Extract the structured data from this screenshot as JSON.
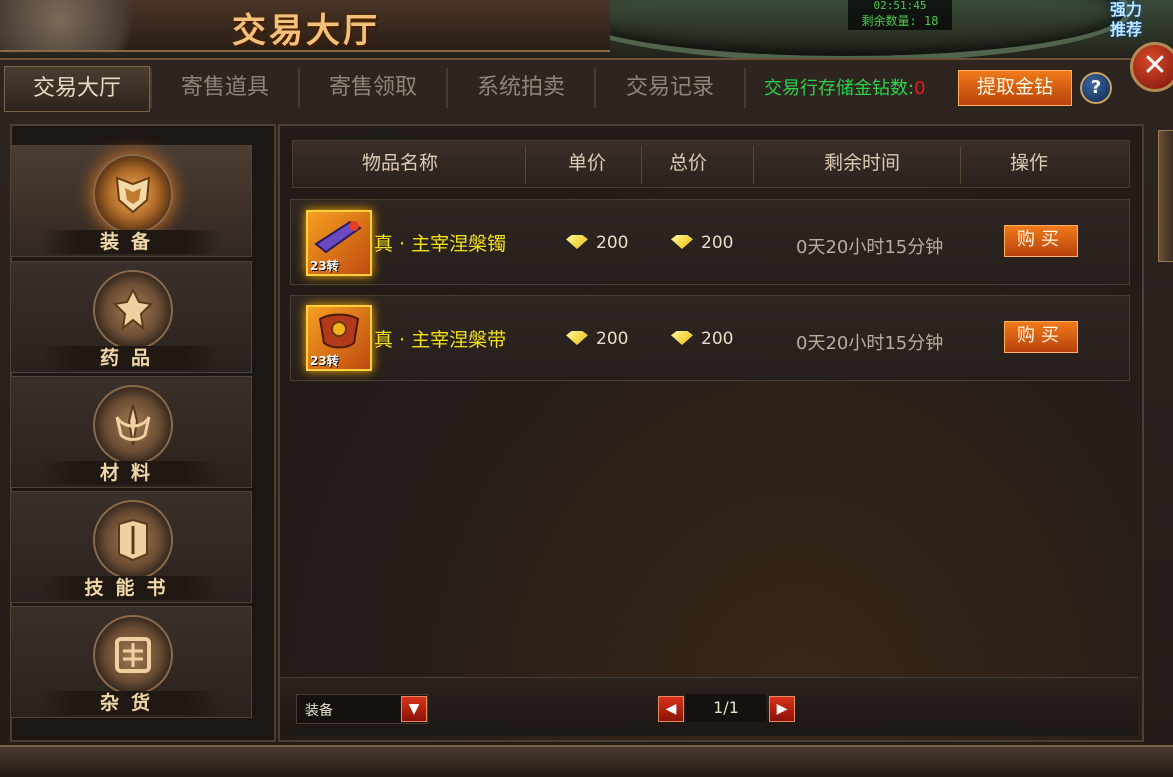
{
  "window": {
    "title": "交易大厅"
  },
  "hud": {
    "timer": "02:51:45",
    "remaining_label": "剩余数量: 18",
    "promo_line1": "强力",
    "promo_line2": "推荐"
  },
  "tabs": [
    {
      "label": "交易大厅",
      "active": true
    },
    {
      "label": "寄售道具",
      "active": false
    },
    {
      "label": "寄售领取",
      "active": false
    },
    {
      "label": "系统拍卖",
      "active": false
    },
    {
      "label": "交易记录",
      "active": false
    }
  ],
  "gold": {
    "label": "交易行存储金钻数:",
    "value": "0",
    "withdraw_label": "提取金钻",
    "help_label": "?"
  },
  "close_label": "✕",
  "categories": [
    {
      "label": "装备",
      "icon": "armor-icon",
      "active": true
    },
    {
      "label": "药品",
      "icon": "potion-icon",
      "active": false
    },
    {
      "label": "材料",
      "icon": "material-icon",
      "active": false
    },
    {
      "label": "技能书",
      "icon": "skillbook-icon",
      "active": false
    },
    {
      "label": "杂货",
      "icon": "misc-icon",
      "active": false
    }
  ],
  "table": {
    "headers": [
      "物品名称",
      "单价",
      "总价",
      "剩余时间",
      "操作"
    ],
    "rows": [
      {
        "name": "真 · 主宰涅槃镯",
        "level": "23转",
        "unit_price": "200",
        "total_price": "200",
        "remaining": "0天20小时15分钟",
        "action": "购买",
        "icon": "bracelet-icon"
      },
      {
        "name": "真 · 主宰涅槃带",
        "level": "23转",
        "unit_price": "200",
        "total_price": "200",
        "remaining": "0天20小时15分钟",
        "action": "购买",
        "icon": "belt-icon"
      }
    ]
  },
  "filter": {
    "selected": "装备"
  },
  "pagination": {
    "page": "1/1",
    "prev": "◀",
    "next": "▶"
  },
  "colors": {
    "accent_orange": "#e0641a",
    "gold_text": "#f3e21a",
    "green_text": "#2bd34a",
    "red_value": "#e21d1d"
  }
}
